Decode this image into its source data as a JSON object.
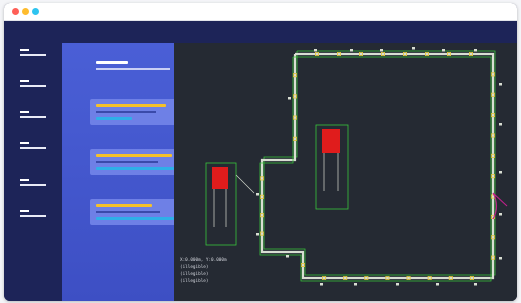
{
  "window": {
    "controls": [
      {
        "name": "close",
        "color": "#ff5f57"
      },
      {
        "name": "minimize",
        "color": "#febc2e"
      },
      {
        "name": "zoom",
        "color": "#2ec4f0"
      }
    ]
  },
  "sidebar": {
    "items": [
      {
        "name": "nav-item-1",
        "icon": "menu-lines-icon"
      },
      {
        "name": "nav-item-2",
        "icon": "menu-lines-icon"
      },
      {
        "name": "nav-item-3",
        "icon": "menu-lines-icon"
      },
      {
        "name": "nav-item-4",
        "icon": "menu-lines-icon"
      },
      {
        "name": "nav-item-5",
        "icon": "menu-lines-icon"
      },
      {
        "name": "nav-item-6",
        "icon": "menu-lines-icon"
      }
    ]
  },
  "layers_panel": {
    "cards": [
      {
        "name": "layer-card-1",
        "highlight": "#f6c12a"
      },
      {
        "name": "layer-card-2",
        "highlight": "#f6c12a"
      },
      {
        "name": "layer-card-3",
        "highlight": "#f6c12a"
      }
    ]
  },
  "canvas": {
    "background": "#252a33",
    "wall_color": "#d8ddd2",
    "outline_color": "#39c43a",
    "node_color": "#e0c43a",
    "device_color": "#e01c1c",
    "door_color": "#c2208c",
    "readout": {
      "lines": [
        "X:0.000m, Y:0.000m",
        "(illegible)",
        "(illegible)",
        "(illegible)"
      ]
    }
  }
}
